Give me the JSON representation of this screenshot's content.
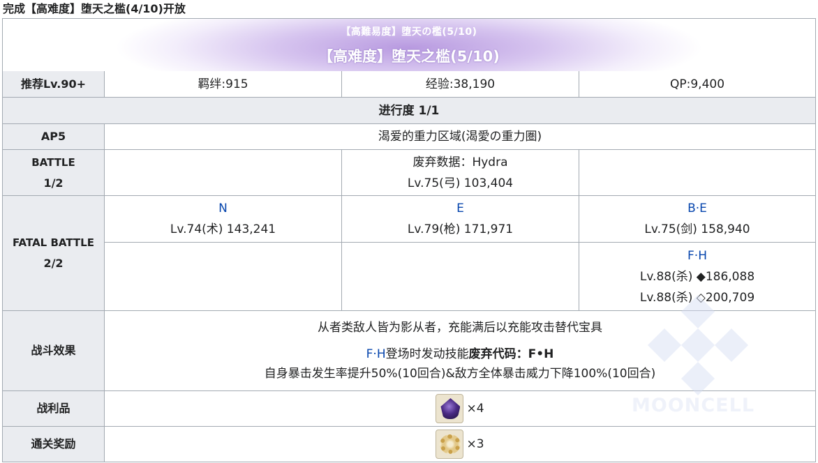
{
  "top_note": "完成【高难度】堕天之槛(4/10)开放",
  "header": {
    "jp_title": "【高難易度】堕天の檻(5/10)",
    "cn_title": "【高难度】堕天之槛(5/10)"
  },
  "rewards_row": {
    "level": "推荐Lv.90+",
    "bond": "羁绊:915",
    "exp": "经验:38,190",
    "qp": "QP:9,400"
  },
  "progress": "进行度 1/1",
  "ap_row": {
    "label": "AP5",
    "field": "渴爱的重力区域(渴愛の重力圏)"
  },
  "battle1": {
    "label_1": "BATTLE",
    "label_2": "1/2",
    "enemy_name": "废弃数据：Hydra",
    "enemy_stats": "Lv.75(弓) 103,404"
  },
  "battle2": {
    "label_1": "FATAL BATTLE",
    "label_2": "2/2",
    "enemies": [
      {
        "name": "N",
        "stats": "Lv.74(术) 143,241"
      },
      {
        "name": "E",
        "stats": "Lv.79(枪) 171,971"
      },
      {
        "name": "B·E",
        "stats": "Lv.75(剑) 158,940"
      }
    ],
    "boss": {
      "name": "F·H",
      "stats_1": "Lv.88(杀) ◆186,088",
      "stats_2": "Lv.88(杀) ◇200,709"
    }
  },
  "effects": {
    "label": "战斗效果",
    "line1": "从者类敌人皆为影从者，充能满后以充能攻击替代宝具",
    "line2_link": "F·H",
    "line2_text": "登场时发动技能",
    "line2_bold": "废弃代码：F•H",
    "line3": "自身暴击发生率提升50%(10回合)&敌方全体暴击威力下降100%(10回合)"
  },
  "loot": {
    "label": "战利品",
    "item_icon": "dark-gem-icon",
    "qty": "×4"
  },
  "clear_reward": {
    "label": "通关奖励",
    "item_icon": "golden-ring-icon",
    "qty": "×3"
  },
  "watermark": "MOONCELL",
  "colors": {
    "link": "#0645ad",
    "header_bg": "#eaecf0",
    "border": "#a2a9b1",
    "banner": "#b89ae0"
  }
}
